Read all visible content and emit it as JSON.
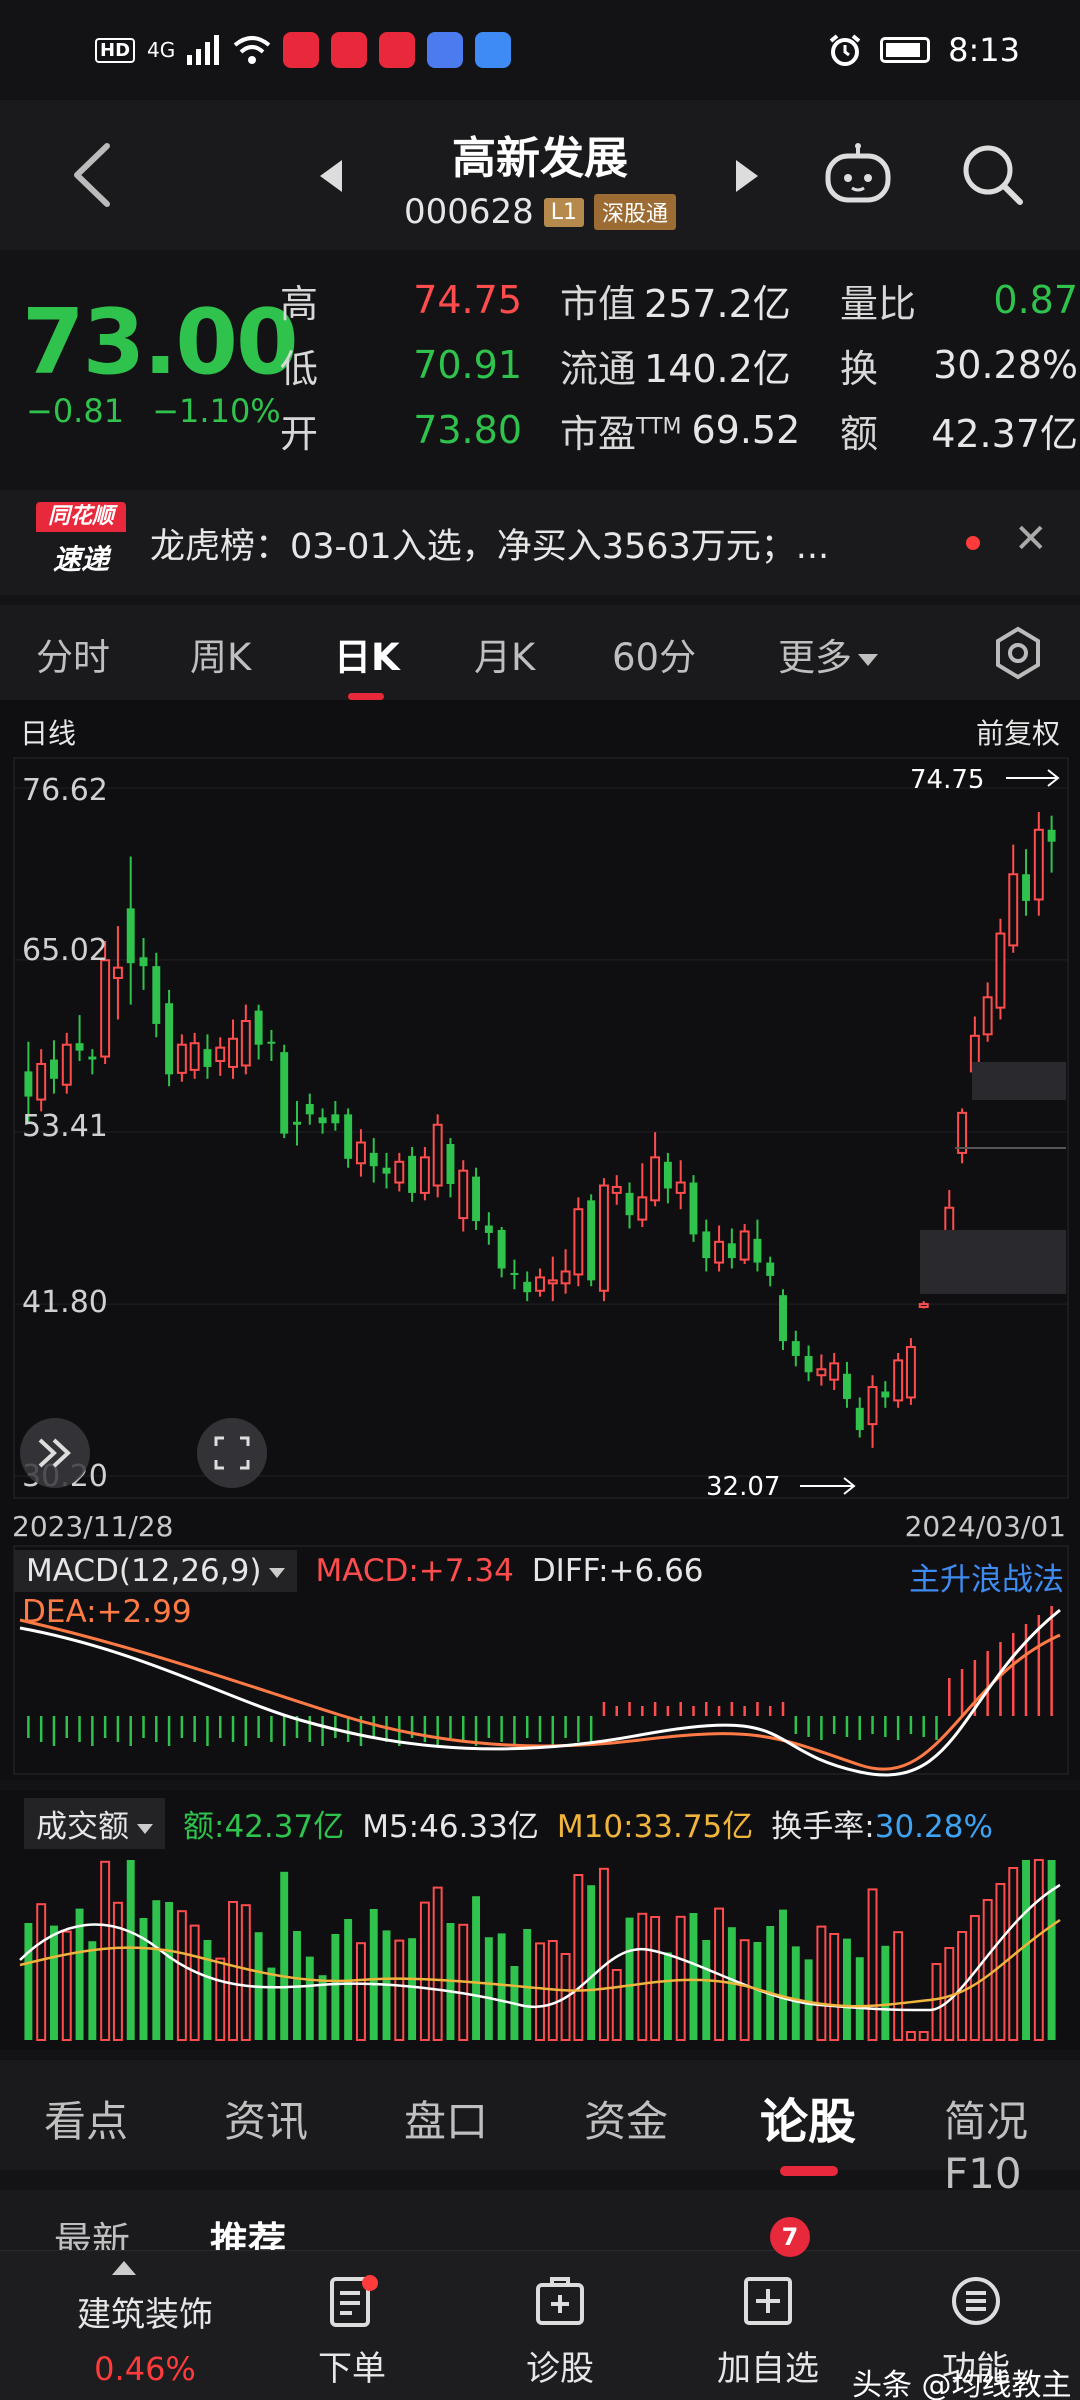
{
  "status": {
    "hd": "HD",
    "net": "4G",
    "time": "8:13"
  },
  "header": {
    "name": "高新发展",
    "code": "000628",
    "badge_level": "L1",
    "badge_connect": "深股通"
  },
  "quote": {
    "price": "73.00",
    "change": "−0.81",
    "change_pct": "−1.10%",
    "high_label": "高",
    "high": "74.75",
    "low_label": "低",
    "low": "70.91",
    "open_label": "开",
    "open": "73.80",
    "mktcap_label": "市值",
    "mktcap": "257.2亿",
    "float_label": "流通",
    "float": "140.2亿",
    "pe_label": "市盈TTM",
    "pe": "69.52",
    "volratio_label": "量比",
    "volratio": "0.87",
    "turnover_label": "换",
    "turnover": "30.28%",
    "amount_label": "额",
    "amount": "42.37亿"
  },
  "news": {
    "logo_top": "同花顺",
    "logo_bottom": "速递",
    "text": "龙虎榜：03-01入选，净买入3563万元；..."
  },
  "tabs": [
    "分时",
    "周K",
    "日K",
    "月K",
    "60分",
    "更多"
  ],
  "active_tab": "日K",
  "kline": {
    "period_label": "日线",
    "adjust_label": "前复权",
    "date_start": "2023/11/28",
    "date_end": "2024/03/01",
    "y_ticks": [
      "76.62",
      "65.02",
      "53.41",
      "41.80",
      "30.20"
    ],
    "max_label": "74.75",
    "min_label": "32.07"
  },
  "macd": {
    "selector": "MACD(12,26,9)",
    "macd": "MACD:+7.34",
    "diff": "DIFF:+6.66",
    "dea": "DEA:+2.99",
    "strategy": "主升浪战法"
  },
  "volume": {
    "selector": "成交额",
    "amount": "额:42.37亿",
    "m5": "M5:46.33亿",
    "m10": "M10:33.75亿",
    "turnover": "换手率:30.28%"
  },
  "bottom_tabs": [
    "看点",
    "资讯",
    "盘口",
    "资金",
    "论股",
    "简况F10"
  ],
  "sub_tabs": [
    "最新",
    "推荐"
  ],
  "nav": {
    "sector_name": "建筑装饰",
    "sector_pct": "0.46%",
    "order": "下单",
    "diagnose": "诊股",
    "add_watch": "加自选",
    "more": "功能",
    "msg_badge": "7",
    "watermark": "头条 @均线教主"
  },
  "colors": {
    "up": "#ff4d4d",
    "down": "#2fc24c",
    "accent": "#e8283b"
  },
  "chart_data": [
    {
      "type": "candlestick",
      "title": "日线",
      "x_range": [
        "2023/11/28",
        "2024/03/01"
      ],
      "ylim": [
        30.2,
        76.62
      ],
      "y_ticks": [
        76.62,
        65.02,
        53.41,
        41.8,
        30.2
      ],
      "annotations": [
        {
          "label": "74.75",
          "kind": "high"
        },
        {
          "label": "32.07",
          "kind": "low"
        }
      ],
      "candles": [
        {
          "o": 57.5,
          "c": 55.8,
          "h": 59.5,
          "l": 54.0
        },
        {
          "o": 55.6,
          "c": 58.0,
          "h": 59.0,
          "l": 54.8
        },
        {
          "o": 58.3,
          "c": 57.0,
          "h": 59.6,
          "l": 56.0
        },
        {
          "o": 56.6,
          "c": 59.3,
          "h": 60.1,
          "l": 56.0
        },
        {
          "o": 59.4,
          "c": 58.9,
          "h": 61.3,
          "l": 58.2
        },
        {
          "o": 58.5,
          "c": 58.3,
          "h": 59.0,
          "l": 57.3
        },
        {
          "o": 58.5,
          "c": 65.0,
          "h": 66.3,
          "l": 58.0
        },
        {
          "o": 63.8,
          "c": 64.5,
          "h": 67.3,
          "l": 61.0
        },
        {
          "o": 68.5,
          "c": 64.8,
          "h": 72.0,
          "l": 62.0
        },
        {
          "o": 65.2,
          "c": 64.6,
          "h": 66.5,
          "l": 63.0
        },
        {
          "o": 64.6,
          "c": 60.7,
          "h": 65.5,
          "l": 59.8
        },
        {
          "o": 62.1,
          "c": 57.3,
          "h": 63.0,
          "l": 56.5
        },
        {
          "o": 57.4,
          "c": 59.3,
          "h": 60.0,
          "l": 56.8
        },
        {
          "o": 57.6,
          "c": 59.4,
          "h": 60.1,
          "l": 57.0
        },
        {
          "o": 59.0,
          "c": 57.8,
          "h": 60.0,
          "l": 57.0
        },
        {
          "o": 58.2,
          "c": 59.1,
          "h": 59.8,
          "l": 57.2
        },
        {
          "o": 57.8,
          "c": 59.7,
          "h": 61.0,
          "l": 57.0
        },
        {
          "o": 57.9,
          "c": 60.9,
          "h": 62.0,
          "l": 57.3
        },
        {
          "o": 61.6,
          "c": 59.3,
          "h": 62.0,
          "l": 58.3
        },
        {
          "o": 59.5,
          "c": 59.4,
          "h": 60.3,
          "l": 58.2
        },
        {
          "o": 58.8,
          "c": 53.3,
          "h": 59.3,
          "l": 53.0
        },
        {
          "o": 54.1,
          "c": 53.9,
          "h": 55.5,
          "l": 52.5
        },
        {
          "o": 55.3,
          "c": 54.6,
          "h": 56.0,
          "l": 53.9
        },
        {
          "o": 54.4,
          "c": 54.0,
          "h": 55.0,
          "l": 53.3
        },
        {
          "o": 54.6,
          "c": 54.0,
          "h": 55.5,
          "l": 53.5
        },
        {
          "o": 54.6,
          "c": 51.6,
          "h": 55.0,
          "l": 51.0
        },
        {
          "o": 51.3,
          "c": 52.7,
          "h": 53.6,
          "l": 50.4
        },
        {
          "o": 52.0,
          "c": 51.1,
          "h": 53.0,
          "l": 50.0
        },
        {
          "o": 51.0,
          "c": 50.6,
          "h": 52.0,
          "l": 49.6
        },
        {
          "o": 50.0,
          "c": 51.4,
          "h": 52.0,
          "l": 49.4
        },
        {
          "o": 51.8,
          "c": 49.3,
          "h": 52.4,
          "l": 48.7
        },
        {
          "o": 49.3,
          "c": 51.7,
          "h": 52.4,
          "l": 48.8
        },
        {
          "o": 49.8,
          "c": 53.9,
          "h": 54.6,
          "l": 49.0
        },
        {
          "o": 52.6,
          "c": 49.9,
          "h": 53.0,
          "l": 49.0
        },
        {
          "o": 47.6,
          "c": 50.8,
          "h": 51.5,
          "l": 46.7
        },
        {
          "o": 50.4,
          "c": 47.4,
          "h": 51.0,
          "l": 46.8
        },
        {
          "o": 47.1,
          "c": 46.6,
          "h": 48.0,
          "l": 45.8
        },
        {
          "o": 46.8,
          "c": 44.2,
          "h": 47.0,
          "l": 43.6
        },
        {
          "o": 43.9,
          "c": 43.8,
          "h": 44.8,
          "l": 42.8
        },
        {
          "o": 43.3,
          "c": 42.6,
          "h": 44.0,
          "l": 42.0
        },
        {
          "o": 42.7,
          "c": 43.6,
          "h": 44.2,
          "l": 42.3
        },
        {
          "o": 43.2,
          "c": 43.4,
          "h": 45.0,
          "l": 42.0
        },
        {
          "o": 43.2,
          "c": 44.0,
          "h": 45.5,
          "l": 42.5
        },
        {
          "o": 43.8,
          "c": 48.2,
          "h": 49.0,
          "l": 43.0
        },
        {
          "o": 48.8,
          "c": 43.4,
          "h": 49.2,
          "l": 43.0
        },
        {
          "o": 42.7,
          "c": 49.8,
          "h": 50.3,
          "l": 42.0
        },
        {
          "o": 49.3,
          "c": 49.7,
          "h": 50.5,
          "l": 48.5
        },
        {
          "o": 49.3,
          "c": 47.8,
          "h": 50.0,
          "l": 46.9
        },
        {
          "o": 47.5,
          "c": 49.0,
          "h": 51.3,
          "l": 47.0
        },
        {
          "o": 48.8,
          "c": 51.7,
          "h": 53.4,
          "l": 48.4
        },
        {
          "o": 51.4,
          "c": 49.6,
          "h": 52.0,
          "l": 48.6
        },
        {
          "o": 49.3,
          "c": 50.0,
          "h": 51.5,
          "l": 48.2
        },
        {
          "o": 50.0,
          "c": 46.5,
          "h": 50.5,
          "l": 46.0
        },
        {
          "o": 46.7,
          "c": 44.9,
          "h": 47.5,
          "l": 44.0
        },
        {
          "o": 44.6,
          "c": 46.0,
          "h": 47.1,
          "l": 44.0
        },
        {
          "o": 45.9,
          "c": 44.9,
          "h": 46.9,
          "l": 44.2
        },
        {
          "o": 44.8,
          "c": 46.7,
          "h": 47.2,
          "l": 44.5
        },
        {
          "o": 46.2,
          "c": 44.6,
          "h": 47.5,
          "l": 44.0
        },
        {
          "o": 44.6,
          "c": 43.7,
          "h": 45.0,
          "l": 43.0
        },
        {
          "o": 42.4,
          "c": 39.3,
          "h": 42.8,
          "l": 38.7
        },
        {
          "o": 39.3,
          "c": 38.3,
          "h": 40.0,
          "l": 37.6
        },
        {
          "o": 38.3,
          "c": 37.2,
          "h": 39.0,
          "l": 36.6
        },
        {
          "o": 37.0,
          "c": 37.4,
          "h": 38.4,
          "l": 36.3
        },
        {
          "o": 36.7,
          "c": 37.8,
          "h": 38.5,
          "l": 36.0
        },
        {
          "o": 37.1,
          "c": 35.4,
          "h": 37.9,
          "l": 34.8
        },
        {
          "o": 34.8,
          "c": 33.3,
          "h": 35.5,
          "l": 32.8
        },
        {
          "o": 33.7,
          "c": 36.2,
          "h": 37.0,
          "l": 32.1
        },
        {
          "o": 35.9,
          "c": 35.5,
          "h": 36.6,
          "l": 34.8
        },
        {
          "o": 35.3,
          "c": 38.0,
          "h": 38.5,
          "l": 34.8
        },
        {
          "o": 35.5,
          "c": 38.9,
          "h": 39.5,
          "l": 35.0
        },
        {
          "o": 41.6,
          "c": 41.8,
          "h": 42.0,
          "l": 41.5
        },
        {
          "o": 45.1,
          "c": 45.3,
          "h": 46.0,
          "l": 44.8
        },
        {
          "o": 45.8,
          "c": 48.3,
          "h": 49.5,
          "l": 45.3
        },
        {
          "o": 52.0,
          "c": 54.7,
          "h": 55.0,
          "l": 51.3
        },
        {
          "o": 57.5,
          "c": 59.9,
          "h": 61.2,
          "l": 56.5
        },
        {
          "o": 60.0,
          "c": 62.5,
          "h": 63.5,
          "l": 59.5
        },
        {
          "o": 61.8,
          "c": 66.8,
          "h": 67.8,
          "l": 61.0
        },
        {
          "o": 66.0,
          "c": 70.8,
          "h": 72.8,
          "l": 65.5
        },
        {
          "o": 70.8,
          "c": 69.0,
          "h": 72.5,
          "l": 68.0
        },
        {
          "o": 69.1,
          "c": 73.8,
          "h": 75.0,
          "l": 68.0
        },
        {
          "o": 73.8,
          "c": 73.0,
          "h": 74.75,
          "l": 70.91
        }
      ]
    },
    {
      "type": "bar",
      "title": "MACD(12,26,9)",
      "series_labels": [
        "DIFF",
        "DEA",
        "MACD"
      ],
      "last": {
        "MACD": 7.34,
        "DIFF": 6.66,
        "DEA": 2.99
      }
    },
    {
      "type": "bar",
      "title": "成交额",
      "last": {
        "amount_yi": 42.37,
        "M5_yi": 46.33,
        "M10_yi": 33.75,
        "turnover_pct": 30.28
      }
    }
  ]
}
